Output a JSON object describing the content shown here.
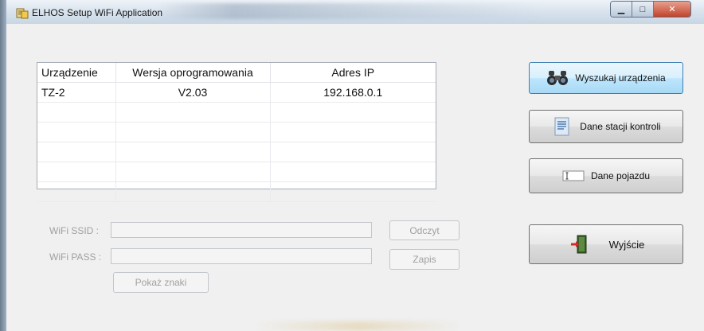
{
  "window": {
    "title": "ELHOS Setup WiFi Application",
    "controls": [
      "minimize",
      "maximize",
      "close"
    ]
  },
  "device_table": {
    "columns": [
      "Urządzenie",
      "Wersja oprogramowania",
      "Adres IP"
    ],
    "rows": [
      [
        "TZ-2",
        "V2.03",
        "192.168.0.1"
      ]
    ],
    "empty_rows": 5
  },
  "wifi": {
    "ssid_label": "WiFi SSID :",
    "ssid_value": "",
    "pass_label": "WiFi PASS :",
    "pass_value": "",
    "read_label": "Odczyt",
    "save_label": "Zapis",
    "show_chars_label": "Pokaż znaki"
  },
  "actions": {
    "search_label": "Wyszukaj urządzenia",
    "station_label": "Dane stacji kontroli",
    "vehicle_label": "Dane pojazdu",
    "exit_label": "Wyjście"
  },
  "icons": {
    "search": "binoculars-icon",
    "station": "document-icon",
    "vehicle": "text-field-icon",
    "exit": "exit-door-icon"
  }
}
